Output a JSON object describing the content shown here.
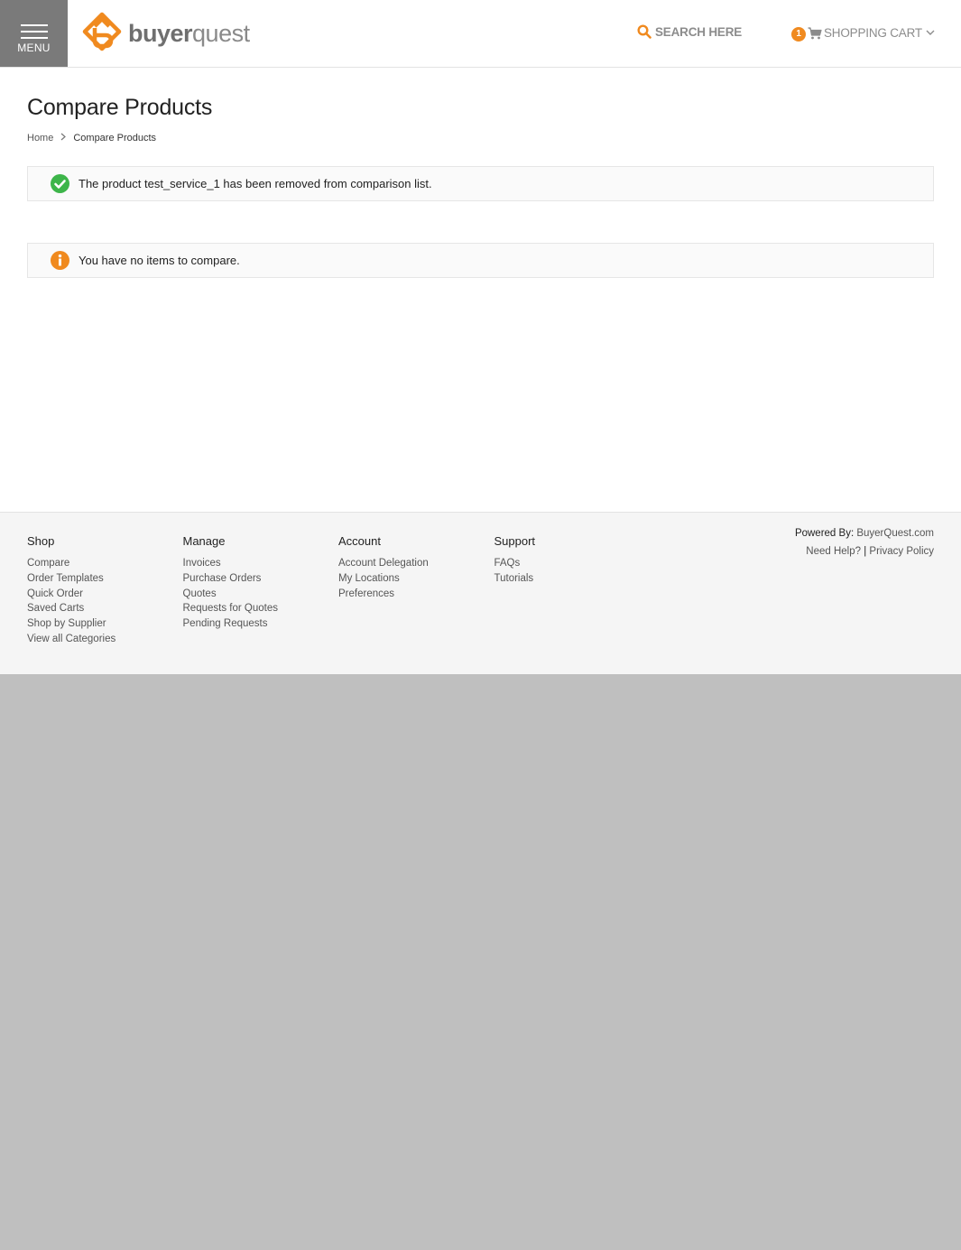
{
  "header": {
    "menu_label": "MENU",
    "logo_bold": "buyer",
    "logo_light": "quest",
    "search_label": "SEARCH HERE",
    "cart_count": "1",
    "cart_label": "SHOPPING CART"
  },
  "main": {
    "title": "Compare Products",
    "breadcrumb": {
      "home": "Home",
      "current": "Compare Products"
    },
    "success_message": "The product test_service_1 has been removed from comparison list.",
    "info_message": "You have no items to compare."
  },
  "footer": {
    "columns": [
      {
        "heading": "Shop",
        "links": [
          "Compare",
          "Order Templates",
          "Quick Order",
          "Saved Carts",
          "Shop by Supplier",
          "View all Categories"
        ]
      },
      {
        "heading": "Manage",
        "links": [
          "Invoices",
          "Purchase Orders",
          "Quotes",
          "Requests for Quotes",
          "Pending Requests"
        ]
      },
      {
        "heading": "Account",
        "links": [
          "Account Delegation",
          "My Locations",
          "Preferences"
        ]
      },
      {
        "heading": "Support",
        "links": [
          "FAQs",
          "Tutorials"
        ]
      }
    ],
    "powered_by_label": "Powered By:",
    "powered_by_link": "BuyerQuest.com",
    "need_help": "Need Help?",
    "separator": "|",
    "privacy": "Privacy Policy"
  },
  "colors": {
    "accent": "#f08a1f",
    "success": "#3db54a",
    "menu_bg": "#7a7a7a",
    "page_bg": "#bfbfbf"
  },
  "icons": {
    "menu": "hamburger-icon",
    "search": "search-icon",
    "cart": "cart-icon",
    "chevron": "chevron-down-icon",
    "success": "check-circle-icon",
    "info": "info-circle-icon"
  }
}
